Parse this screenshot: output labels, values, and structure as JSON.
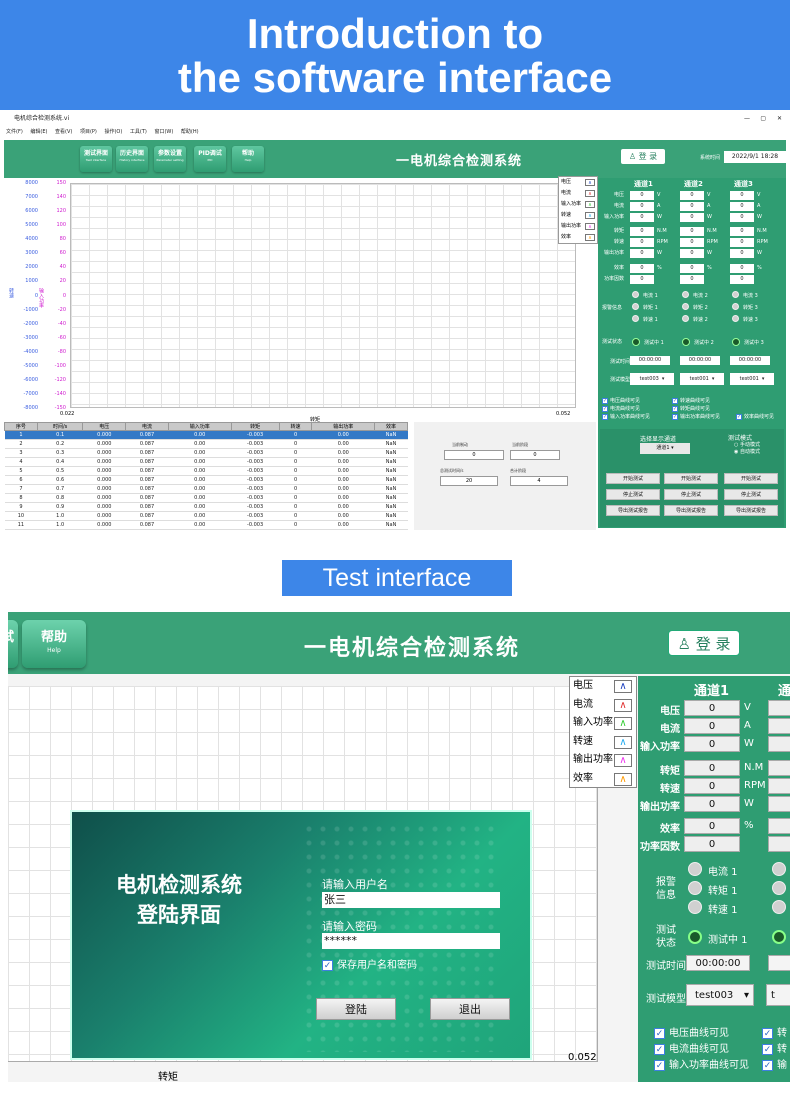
{
  "banner_top": {
    "line1": "Introduction to",
    "line2": "the software interface"
  },
  "banner_mid": "Test interface",
  "shot1": {
    "window_title": "电机综合检测系统.vi",
    "window_controls": [
      "—",
      "▢",
      "✕"
    ],
    "menu": [
      "文件(F)",
      "编辑(E)",
      "查看(V)",
      "项目(P)",
      "操作(O)",
      "工具(T)",
      "窗口(W)",
      "帮助(H)"
    ],
    "nav": [
      {
        "label": "测试界面",
        "sub": "Test interface"
      },
      {
        "label": "历史界面",
        "sub": "History interface"
      },
      {
        "label": "参数设置",
        "sub": "Parameter setting"
      },
      {
        "label": "PID调试",
        "sub": "PID"
      },
      {
        "label": "帮助",
        "sub": "Help"
      }
    ],
    "app_title": "一电机综合检测系统",
    "login": "登 录",
    "clock_label": "系统时间",
    "clock_value": "2022/9/1 18:28",
    "y_ticks_left": [
      "8000",
      "7000",
      "6000",
      "5000",
      "4000",
      "3000",
      "2000",
      "1000",
      "0",
      "-1000",
      "-2000",
      "-3000",
      "-4000",
      "-5000",
      "-6000",
      "-7000",
      "-8000"
    ],
    "y_ticks_right": [
      "150",
      "140",
      "120",
      "100",
      "80",
      "60",
      "40",
      "20",
      "0",
      "-20",
      "-40",
      "-60",
      "-80",
      "-100",
      "-120",
      "-140",
      "-150"
    ],
    "y_label_left": "转速",
    "y_label_right": "输入功率",
    "x_min": "0.022",
    "x_max": "0.052",
    "x_label": "转矩",
    "legend": [
      {
        "name": "电压",
        "color": "#1a3fbf"
      },
      {
        "name": "电流",
        "color": "#e03030"
      },
      {
        "name": "输入功率",
        "color": "#33cc33"
      },
      {
        "name": "转速",
        "color": "#22aaee"
      },
      {
        "name": "输出功率",
        "color": "#ee33ee"
      },
      {
        "name": "效率",
        "color": "#ff9900"
      }
    ],
    "channels": [
      "通道1",
      "通道2",
      "通道3"
    ],
    "rows": [
      {
        "label": "电压",
        "unit": "V"
      },
      {
        "label": "电流",
        "unit": "A"
      },
      {
        "label": "输入功率",
        "unit": "W"
      },
      {
        "label": "转矩",
        "unit": "N.M"
      },
      {
        "label": "转速",
        "unit": "RPM"
      },
      {
        "label": "输出功率",
        "unit": "W"
      },
      {
        "label": "效率",
        "unit": "%"
      },
      {
        "label": "功率因数",
        "unit": ""
      }
    ],
    "value": "0",
    "alarm_label": "报警信息",
    "alarms": [
      [
        "电流 1",
        "转矩 1",
        "转速 1"
      ],
      [
        "电流 2",
        "转矩 2",
        "转速 2"
      ],
      [
        "电流 3",
        "转矩 3",
        "转速 3"
      ]
    ],
    "status_label": "测试状态",
    "status": [
      "测试中 1",
      "测试中 2",
      "测试中 3"
    ],
    "time_label": "测试时间",
    "time_value": "00:00:00",
    "model_label": "测试模型",
    "models": [
      "test003",
      "test001",
      "test001"
    ],
    "checks": [
      "电压曲线可见",
      "转速曲线可见",
      "电流曲线可见",
      "转矩曲线可见",
      "输入功率曲线可见",
      "输出功率曲线可见",
      "效率曲线可见"
    ],
    "select_channel_label": "选择显示通道",
    "select_channel_value": "通道1",
    "mode_label": "测试模式",
    "modes": [
      "手动模式",
      "自动模式"
    ],
    "buttons": [
      "开始测试",
      "停止测试",
      "导出测试报告"
    ],
    "table_headers": [
      "序号",
      "时间/s",
      "电压",
      "电流",
      "输入功率",
      "转矩",
      "转速",
      "输出功率",
      "效率"
    ],
    "table_rows": [
      [
        "1",
        "0.1",
        "0.000",
        "0.087",
        "0.00",
        "-0.003",
        "0",
        "0.00",
        "NaN"
      ],
      [
        "2",
        "0.2",
        "0.000",
        "0.087",
        "0.00",
        "-0.003",
        "0",
        "0.00",
        "NaN"
      ],
      [
        "3",
        "0.3",
        "0.000",
        "0.087",
        "0.00",
        "-0.003",
        "0",
        "0.00",
        "NaN"
      ],
      [
        "4",
        "0.4",
        "0.000",
        "0.087",
        "0.00",
        "-0.003",
        "0",
        "0.00",
        "NaN"
      ],
      [
        "5",
        "0.5",
        "0.000",
        "0.087",
        "0.00",
        "-0.003",
        "0",
        "0.00",
        "NaN"
      ],
      [
        "6",
        "0.6",
        "0.000",
        "0.087",
        "0.00",
        "-0.003",
        "0",
        "0.00",
        "NaN"
      ],
      [
        "7",
        "0.7",
        "0.000",
        "0.087",
        "0.00",
        "-0.003",
        "0",
        "0.00",
        "NaN"
      ],
      [
        "8",
        "0.8",
        "0.000",
        "0.087",
        "0.00",
        "-0.003",
        "0",
        "0.00",
        "NaN"
      ],
      [
        "9",
        "0.9",
        "0.000",
        "0.087",
        "0.00",
        "-0.003",
        "0",
        "0.00",
        "NaN"
      ],
      [
        "10",
        "1.0",
        "0.000",
        "0.087",
        "0.00",
        "-0.003",
        "0",
        "0.00",
        "NaN"
      ],
      [
        "11",
        "1.0",
        "0.000",
        "0.087",
        "0.00",
        "-0.003",
        "0",
        "0.00",
        "NaN"
      ],
      [
        "12",
        "1.1",
        "0.000",
        "0.087",
        "0.00",
        "-0.003",
        "0",
        "0.00",
        "NaN"
      ]
    ],
    "cur_process_label": "当前制动",
    "cur_process_value": "0",
    "cur_stage_label": "当前阶段",
    "cur_stage_value": "0",
    "total_time_label": "总测试时间/s",
    "total_time_value": "20",
    "total_stage_label": "合计阶段",
    "total_stage_value": "4"
  },
  "shot2": {
    "nav_partial": "试",
    "nav_help": {
      "label": "帮助",
      "sub": "Help"
    },
    "app_title": "一电机综合检测系统",
    "login": "登 录",
    "legend": [
      "电压",
      "电流",
      "输入功率",
      "转速",
      "输出功率",
      "效率"
    ],
    "channel": "通道1",
    "channel_partial": "通",
    "value": "0",
    "x_max": "0.052",
    "x_label": "转矩",
    "alarm_label": "报警信息",
    "alarms": [
      "电流 1",
      "转矩 1",
      "转速 1"
    ],
    "status_label": "测试状态",
    "status": "测试中 1",
    "time_label": "测试时间",
    "time_value": "00:00:00",
    "model_label": "测试模型",
    "model": "test003",
    "checks": [
      "电压曲线可见",
      "电流曲线可见",
      "输入功率曲线可见"
    ],
    "check_partial": [
      "转",
      "转",
      "输"
    ],
    "login_title": [
      "电机检测系统",
      "登陆界面"
    ],
    "username_label": "请输入用户名",
    "username_value": "张三",
    "password_label": "请输入密码",
    "password_value": "******",
    "remember_label": "保存用户名和密码",
    "login_btn": "登陆",
    "exit_btn": "退出"
  }
}
